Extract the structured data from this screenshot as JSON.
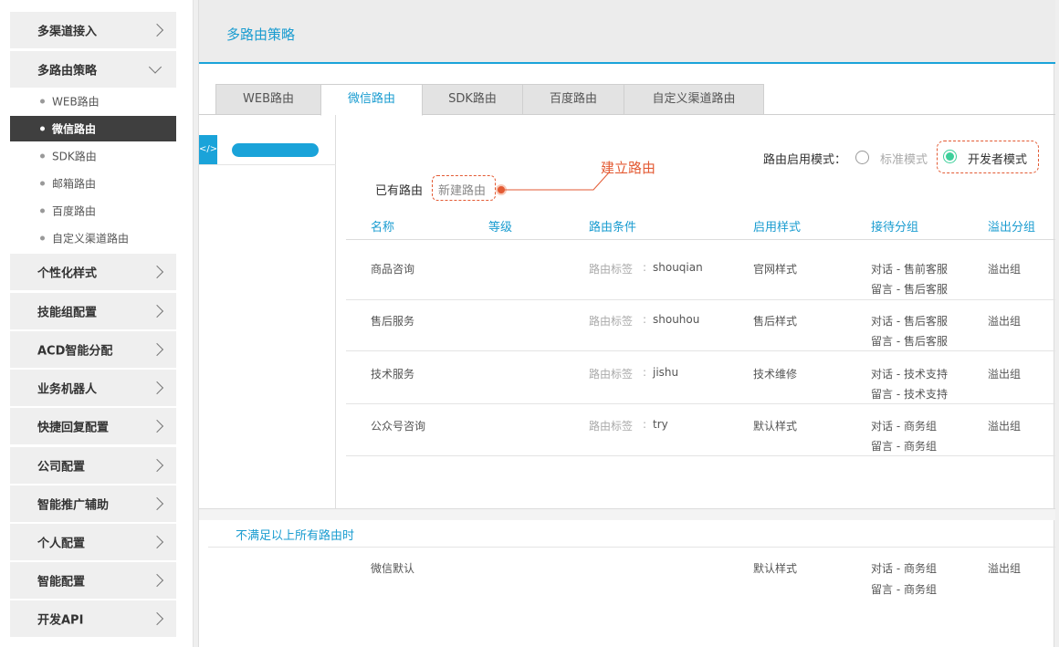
{
  "sidebar": {
    "items": [
      {
        "label": "多渠道接入"
      },
      {
        "label": "多路由策略"
      },
      {
        "label": "个性化样式"
      },
      {
        "label": "技能组配置"
      },
      {
        "label": "ACD智能分配"
      },
      {
        "label": "业务机器人"
      },
      {
        "label": "快捷回复配置"
      },
      {
        "label": "公司配置"
      },
      {
        "label": "智能推广辅助"
      },
      {
        "label": "个人配置"
      },
      {
        "label": "智能配置"
      },
      {
        "label": "开发API"
      }
    ],
    "sub_items": [
      {
        "label": "WEB路由"
      },
      {
        "label": "微信路由",
        "active": true
      },
      {
        "label": "SDK路由"
      },
      {
        "label": "邮箱路由"
      },
      {
        "label": "百度路由"
      },
      {
        "label": "自定义渠道路由"
      }
    ]
  },
  "header": {
    "title": "多路由策略"
  },
  "tabs": [
    {
      "label": "WEB路由"
    },
    {
      "label": "微信路由",
      "active": true
    },
    {
      "label": "SDK路由"
    },
    {
      "label": "百度路由"
    },
    {
      "label": "自定义渠道路由"
    }
  ],
  "mode": {
    "label": "路由启用模式：",
    "standard": "标准模式",
    "developer": "开发者模式",
    "selected": "developer"
  },
  "routes": {
    "existing_label": "已有路由",
    "new_route": "新建路由",
    "callout": "建立路由"
  },
  "table": {
    "headers": [
      "名称",
      "等级",
      "路由条件",
      "启用样式",
      "接待分组",
      "溢出分组"
    ],
    "rows": [
      {
        "name": "商品咨询",
        "cond_label": "路由标签",
        "colon": ":",
        "cond_value": "shouqian",
        "style": "官网样式",
        "recv1": "对话 - 售前客服",
        "recv2": "留言 - 售后客服",
        "overflow": "溢出组"
      },
      {
        "name": "售后服务",
        "cond_label": "路由标签",
        "colon": ":",
        "cond_value": "shouhou",
        "style": "售后样式",
        "recv1": "对话 - 售后客服",
        "recv2": "留言 - 售后客服",
        "overflow": "溢出组"
      },
      {
        "name": "技术服务",
        "cond_label": "路由标签",
        "colon": ":",
        "cond_value": "jishu",
        "style": "技术维修",
        "recv1": "对话 - 技术支持",
        "recv2": "留言 - 技术支持",
        "overflow": "溢出组"
      },
      {
        "name": "公众号咨询",
        "cond_label": "路由标签",
        "colon": ":",
        "cond_value": "try",
        "style": "默认样式",
        "recv1": "对话 - 商务组",
        "recv2": "留言 - 商务组",
        "overflow": "溢出组"
      }
    ]
  },
  "default_route": {
    "heading": "不满足以上所有路由时",
    "name": "微信默认",
    "style": "默认样式",
    "recv1": "对话 - 商务组",
    "recv2": "留言 - 商务组",
    "overflow": "溢出组"
  },
  "colors": {
    "accent": "#1aa3d9",
    "highlight": "#e35a33",
    "radio_on": "#3ccf9a"
  }
}
